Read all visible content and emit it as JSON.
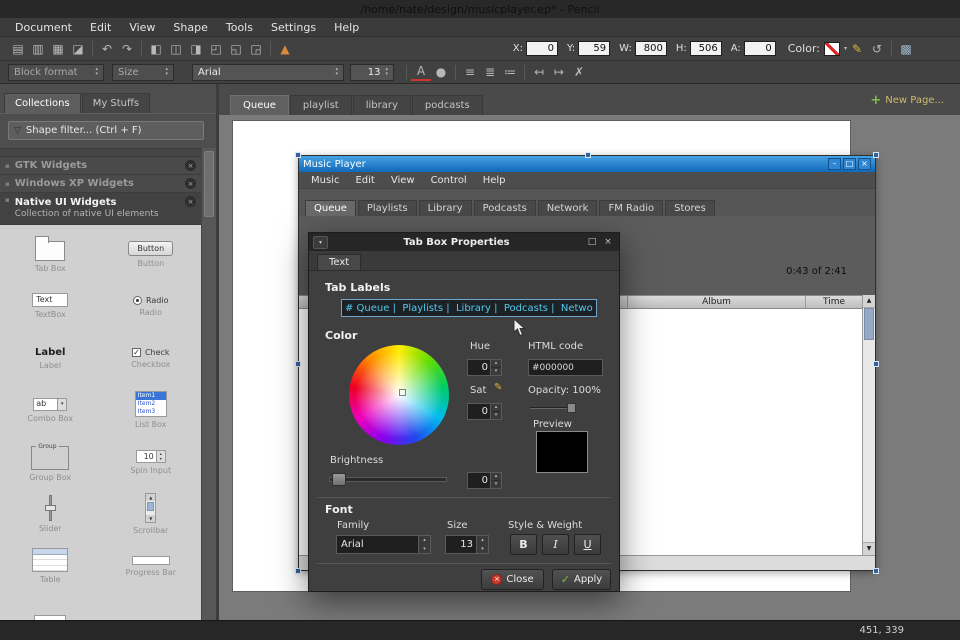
{
  "titlebar": {
    "title": "/home/nate/design/musicplayer.ep* - Pencil"
  },
  "menubar": {
    "items": [
      "Document",
      "Edit",
      "View",
      "Shape",
      "Tools",
      "Settings",
      "Help"
    ]
  },
  "toolbar": {
    "x_label": "X:",
    "x_value": "0",
    "y_label": "Y:",
    "y_value": "59",
    "w_label": "W:",
    "w_value": "800",
    "h_label": "H:",
    "h_value": "506",
    "a_label": "A:",
    "a_value": "0",
    "color_label": "Color:"
  },
  "format_bar": {
    "block_format": "Block format",
    "size_label": "Size",
    "font_family": "Arial",
    "font_size": "13"
  },
  "sidebar": {
    "tabs": [
      {
        "label": "Collections"
      },
      {
        "label": "My Stuffs"
      }
    ],
    "filter": {
      "placeholder": "Shape filter... (Ctrl + F)"
    },
    "sections": [
      {
        "title": "GTK Widgets"
      },
      {
        "title": "Windows XP Widgets"
      },
      {
        "title": "Native UI Widgets",
        "subtitle": "Collection of native UI elements"
      }
    ],
    "widgets": [
      {
        "label": "Tab Box"
      },
      {
        "label": "Button",
        "icon_text": "Button"
      },
      {
        "label": "TextBox",
        "icon_text": "Text"
      },
      {
        "label": "Radio",
        "icon_text": "Radio"
      },
      {
        "label": "Label",
        "icon_text": "Label"
      },
      {
        "label": "Checkbox",
        "icon_text": "Check"
      },
      {
        "label": "Combo Box",
        "icon_text": "ab"
      },
      {
        "label": "List Box",
        "items": [
          "Item1",
          "Item2",
          "Item3"
        ]
      },
      {
        "label": "Group Box",
        "icon_text": "Group"
      },
      {
        "label": "Spin Input",
        "icon_text": "10"
      },
      {
        "label": "Slider"
      },
      {
        "label": "Scrollbar"
      },
      {
        "label": "Table"
      },
      {
        "label": "Progress Bar"
      },
      {
        "label": ""
      }
    ]
  },
  "page_tabs": {
    "tabs": [
      {
        "label": "Queue"
      },
      {
        "label": "playlist"
      },
      {
        "label": "library"
      },
      {
        "label": "podcasts"
      }
    ],
    "new_page_label": "New Page..."
  },
  "mockup": {
    "title": "Music Player",
    "window_buttons": {
      "minimize": "–",
      "maximize": "□",
      "close": "×"
    },
    "menu": [
      "Music",
      "Edit",
      "View",
      "Control",
      "Help"
    ],
    "tabs": [
      "Queue",
      "Playlists",
      "Library",
      "Podcasts",
      "Network",
      "FM Radio",
      "Stores"
    ],
    "time_text": "0:43 of 2:41",
    "columns": [
      "Album",
      "Time"
    ]
  },
  "dialog": {
    "title": "Tab Box Properties",
    "tab_label": "Text",
    "tab_labels_heading": "Tab Labels",
    "tab_labels_value": "# Queue |  Playlists |  Library |  Podcasts |  Network |",
    "color_heading": "Color",
    "hue_label": "Hue",
    "hue_value": "0",
    "sat_label": "Sat",
    "sat_value": "0",
    "html_code_label": "HTML code",
    "html_code_value": "#000000",
    "opacity_label": "Opacity: 100%",
    "preview_label": "Preview",
    "brightness_label": "Brightness",
    "brightness_value": "0",
    "font_heading": "Font",
    "family_label": "Family",
    "family_value": "Arial",
    "size_label": "Size",
    "size_value": "13",
    "style_label": "Style & Weight",
    "bold_label": "B",
    "italic_label": "I",
    "underline_label": "U",
    "close_label": "Close",
    "apply_label": "Apply"
  },
  "statusbar": {
    "coords": "451, 339"
  },
  "colors": {
    "mockup_titlebar": "#1e7fd0",
    "dialog_input_text": "#54c8ec",
    "selection_handle": "#34629e",
    "apply_green": "#7ac142",
    "close_red": "#cc3a2f"
  },
  "icons": {
    "funnel": "▽",
    "close_x": "×",
    "plus": "+",
    "bullet": "▪",
    "row1": [
      "▤",
      "▥",
      "▦",
      "◪",
      "↶",
      "↷",
      "◧",
      "◫",
      "◨",
      "◰",
      "◱",
      "◲",
      "▲"
    ],
    "picker": "✎",
    "reset": "↺",
    "grid": "▩",
    "row2": [
      "A",
      "●",
      "≡",
      "≣",
      "≔",
      "↤",
      "↦",
      "✗"
    ],
    "spin_up": "▴",
    "spin_down": "▾",
    "combo_arrow": "▾",
    "scroll_up": "▲",
    "scroll_down": "▼",
    "check": "✓",
    "menu_arrow": "▾",
    "restore": "□",
    "pencil": "✎"
  }
}
